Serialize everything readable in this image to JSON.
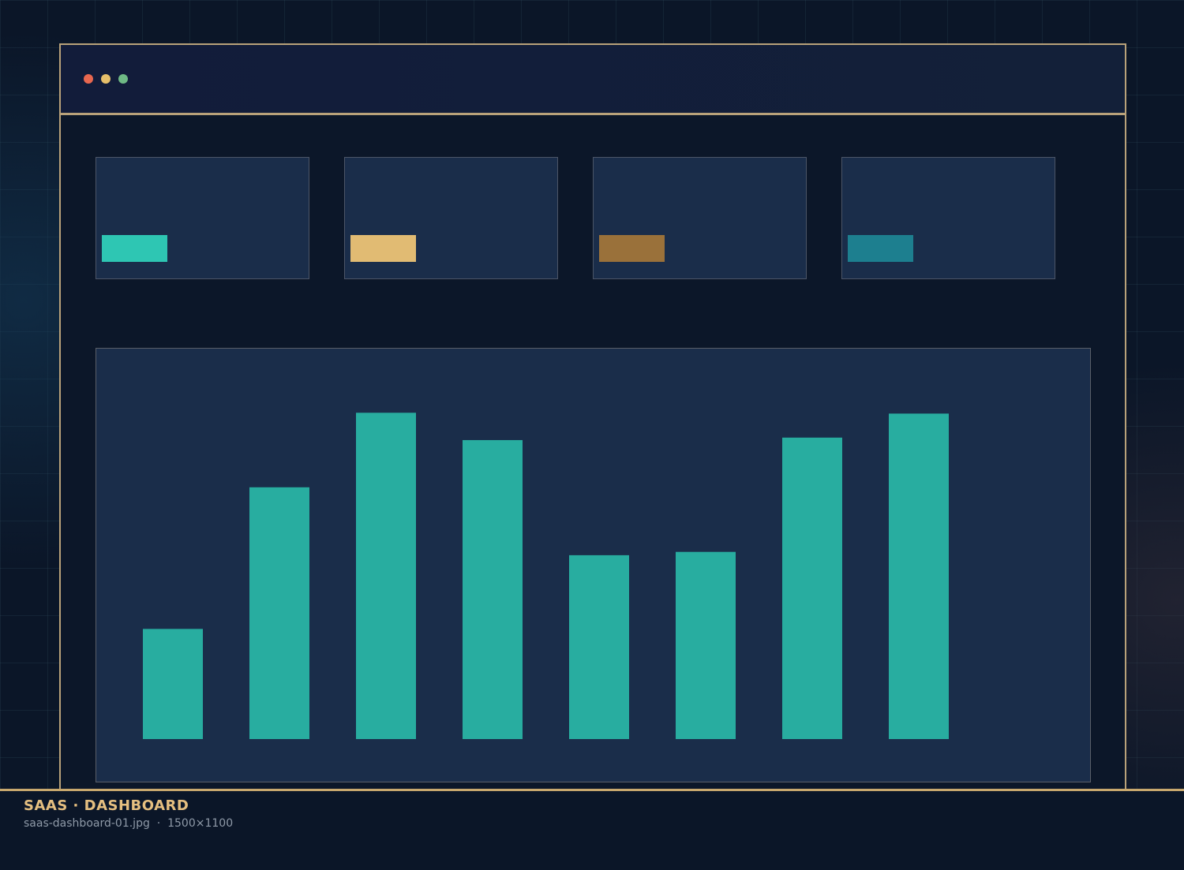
{
  "window": {
    "controls": [
      {
        "name": "close",
        "color": "#e8674f"
      },
      {
        "name": "minimize",
        "color": "#e6bf6a"
      },
      {
        "name": "zoom",
        "color": "#6fb985"
      }
    ]
  },
  "stat_cards": [
    {
      "accent": "#2ec6b3"
    },
    {
      "accent": "#e1bb73"
    },
    {
      "accent": "#9a713a"
    },
    {
      "accent": "#1d7f8f"
    }
  ],
  "chart_data": {
    "type": "bar",
    "values": [
      133,
      304,
      394,
      361,
      222,
      226,
      364,
      393
    ],
    "ylim": [
      0,
      420
    ],
    "color": "#28ada0",
    "grid": false
  },
  "footer": {
    "title": "SAAS · DASHBOARD",
    "file_name": "saas-dashboard-01.jpg",
    "separator": "·",
    "dimensions": "1500×1100"
  }
}
